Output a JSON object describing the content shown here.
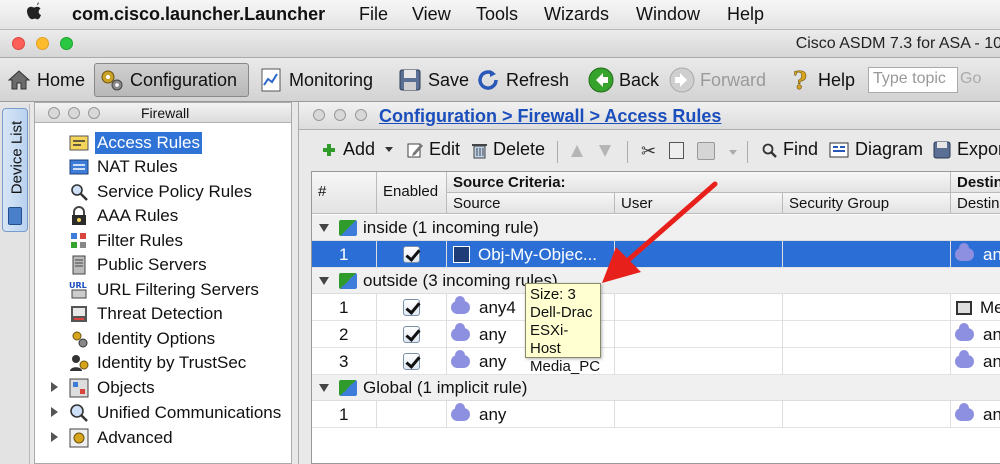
{
  "menubar": {
    "app_name": "com.cisco.launcher.Launcher",
    "items": [
      "File",
      "View",
      "Tools",
      "Wizards",
      "Window",
      "Help"
    ]
  },
  "window": {
    "title": "Cisco ASDM 7.3 for ASA - 10"
  },
  "toolbar": {
    "home": "Home",
    "configuration": "Configuration",
    "monitoring": "Monitoring",
    "save": "Save",
    "refresh": "Refresh",
    "back": "Back",
    "forward": "Forward",
    "help": "Help",
    "search_placeholder": "Type topic",
    "go": "Go"
  },
  "device_list": {
    "label": "Device List"
  },
  "nav": {
    "title": "Firewall",
    "items": [
      {
        "label": "Access Rules",
        "icon": "access-rules-icon"
      },
      {
        "label": "NAT Rules",
        "icon": "nat-rules-icon"
      },
      {
        "label": "Service Policy Rules",
        "icon": "magnifier-icon"
      },
      {
        "label": "AAA Rules",
        "icon": "lock-icon"
      },
      {
        "label": "Filter Rules",
        "icon": "filter-icon"
      },
      {
        "label": "Public Servers",
        "icon": "server-icon"
      },
      {
        "label": "URL Filtering Servers",
        "icon": "url-icon"
      },
      {
        "label": "Threat Detection",
        "icon": "threat-icon"
      },
      {
        "label": "Identity Options",
        "icon": "identity-icon"
      },
      {
        "label": "Identity by TrustSec",
        "icon": "trustsec-icon"
      },
      {
        "label": "Objects",
        "icon": "objects-icon"
      },
      {
        "label": "Unified Communications",
        "icon": "uc-icon"
      },
      {
        "label": "Advanced",
        "icon": "advanced-icon"
      }
    ]
  },
  "breadcrumb": "Configuration > Firewall > Access Rules",
  "actions": {
    "add": "Add",
    "edit": "Edit",
    "delete": "Delete",
    "find": "Find",
    "diagram": "Diagram",
    "export": "Export"
  },
  "table": {
    "headers": {
      "number": "#",
      "enabled": "Enabled",
      "source_criteria": "Source Criteria:",
      "source": "Source",
      "user": "User",
      "security_group": "Security Group",
      "destination_criteria": "Destination Criteria:",
      "destination": "Destination"
    },
    "groups": [
      {
        "label": "inside (1 incoming rule)"
      },
      {
        "label": "outside (3 incoming rules)"
      },
      {
        "label": "Global (1 implicit rule)"
      }
    ],
    "rows": [
      {
        "num": "1",
        "source": "Obj-My-Objec...",
        "dest": "any"
      },
      {
        "num": "1",
        "source": "any4",
        "dest": "Me"
      },
      {
        "num": "2",
        "source": "any",
        "dest": "any"
      },
      {
        "num": "3",
        "source": "any",
        "dest": "any"
      },
      {
        "num": "1",
        "source": "any",
        "dest": "any"
      }
    ]
  },
  "tooltip": {
    "lines": [
      "Size: 3",
      "Dell-Drac",
      "ESXi-Host",
      "Media_PC"
    ]
  },
  "colors": {
    "selection": "#2b6fd6",
    "link": "#1a4ebd",
    "annotation_arrow": "#e8201c",
    "tooltip_bg": "#ffffd2"
  }
}
